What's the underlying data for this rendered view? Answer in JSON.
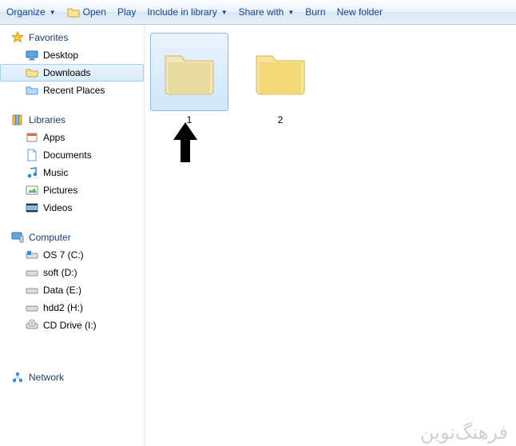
{
  "toolbar": {
    "organize": "Organize",
    "open": "Open",
    "play": "Play",
    "include": "Include in library",
    "share": "Share with",
    "burn": "Burn",
    "newfolder": "New folder"
  },
  "sidebar": {
    "favorites": {
      "label": "Favorites",
      "items": [
        "Desktop",
        "Downloads",
        "Recent Places"
      ]
    },
    "libraries": {
      "label": "Libraries",
      "items": [
        "Apps",
        "Documents",
        "Music",
        "Pictures",
        "Videos"
      ]
    },
    "computer": {
      "label": "Computer",
      "items": [
        "OS 7 (C:)",
        "soft (D:)",
        "Data (E:)",
        "hdd2 (H:)",
        "CD Drive (I:)"
      ]
    },
    "network": {
      "label": "Network"
    }
  },
  "content": {
    "folders": [
      "1",
      "2"
    ],
    "selected": 0
  },
  "watermark": {
    "line1": "فرهنگ‌نوین",
    "line2": ""
  }
}
